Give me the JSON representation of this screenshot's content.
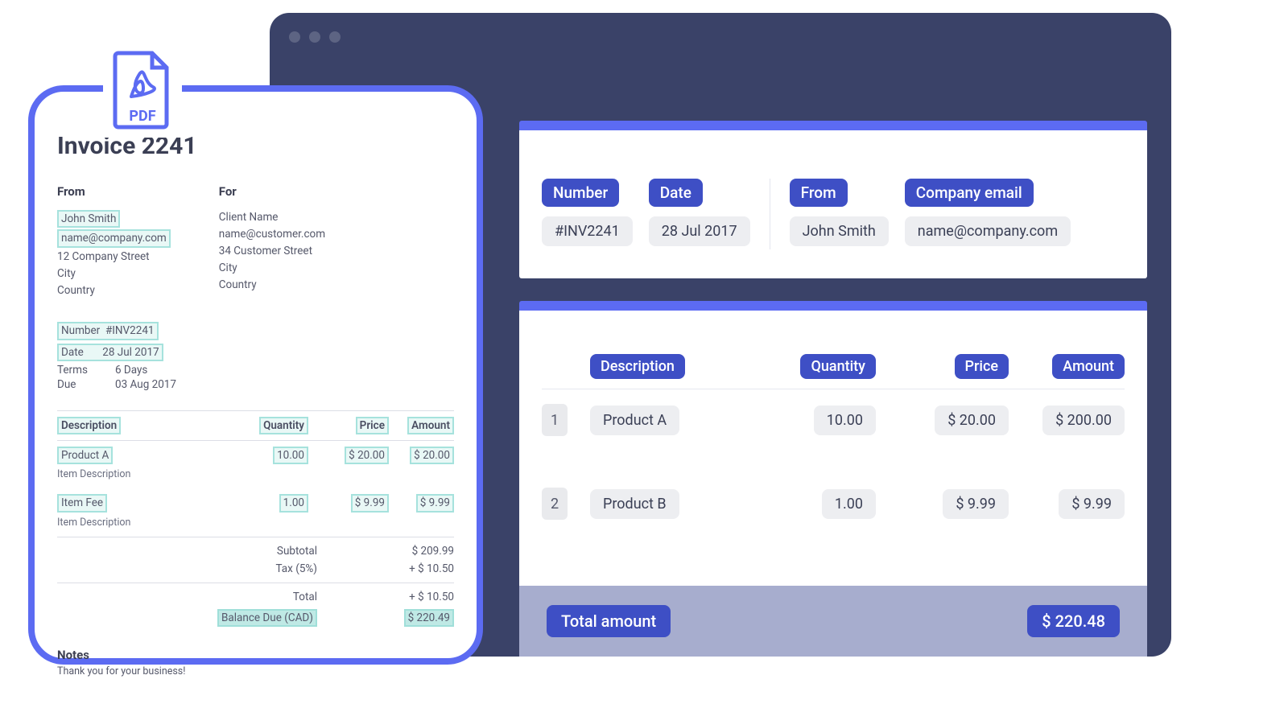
{
  "window": {
    "title": ""
  },
  "summary": {
    "groups": [
      {
        "label": "Number",
        "value": "#INV2241"
      },
      {
        "label": "Date",
        "value": "28 Jul 2017"
      },
      {
        "label": "From",
        "value": "John Smith"
      },
      {
        "label": "Company email",
        "value": "name@company.com"
      }
    ]
  },
  "items": {
    "headers": [
      "Description",
      "Quantity",
      "Price",
      "Amount"
    ],
    "rows": [
      {
        "idx": "1",
        "desc": "Product A",
        "qty": "10.00",
        "price": "$ 20.00",
        "amount": "$ 200.00"
      },
      {
        "idx": "2",
        "desc": "Product B",
        "qty": "1.00",
        "price": "$ 9.99",
        "amount": "$ 9.99"
      }
    ],
    "total_label": "Total amount",
    "total_value": "$ 220.48"
  },
  "pdf": {
    "icon_label": "PDF",
    "title": "Invoice 2241",
    "from": {
      "heading": "From",
      "name": "John Smith",
      "email": "name@company.com",
      "street": "12 Company Street",
      "city": "City",
      "country": "Country"
    },
    "for": {
      "heading": "For",
      "name": "Client Name",
      "email": "name@customer.com",
      "street": "34 Customer Street",
      "city": "City",
      "country": "Country"
    },
    "meta": [
      {
        "k": "Number",
        "v": "#INV2241",
        "hl": true
      },
      {
        "k": "Date",
        "v": "28 Jul 2017",
        "hl": true
      },
      {
        "k": "Terms",
        "v": "6 Days",
        "hl": false
      },
      {
        "k": "Due",
        "v": "03 Aug 2017",
        "hl": false
      }
    ],
    "table": {
      "headers": [
        "Description",
        "Quantity",
        "Price",
        "Amount"
      ],
      "rows": [
        {
          "name": "Product A",
          "sub": "Item Description",
          "qty": "10.00",
          "price": "$ 20.00",
          "amount": "$ 20.00"
        },
        {
          "name": "Item Fee",
          "sub": "Item Description",
          "qty": "1.00",
          "price": "$ 9.99",
          "amount": "$ 9.99"
        }
      ]
    },
    "totals": {
      "subtotal_label": "Subtotal",
      "subtotal_value": "$ 209.99",
      "tax_label": "Tax (5%)",
      "tax_value": "+ $ 10.50",
      "total_label": "Total",
      "total_value": "+ $ 10.50",
      "balance_label": "Balance Due (CAD)",
      "balance_value": "$ 220.49"
    },
    "notes": {
      "heading": "Notes",
      "body": "Thank you for your business!"
    }
  }
}
